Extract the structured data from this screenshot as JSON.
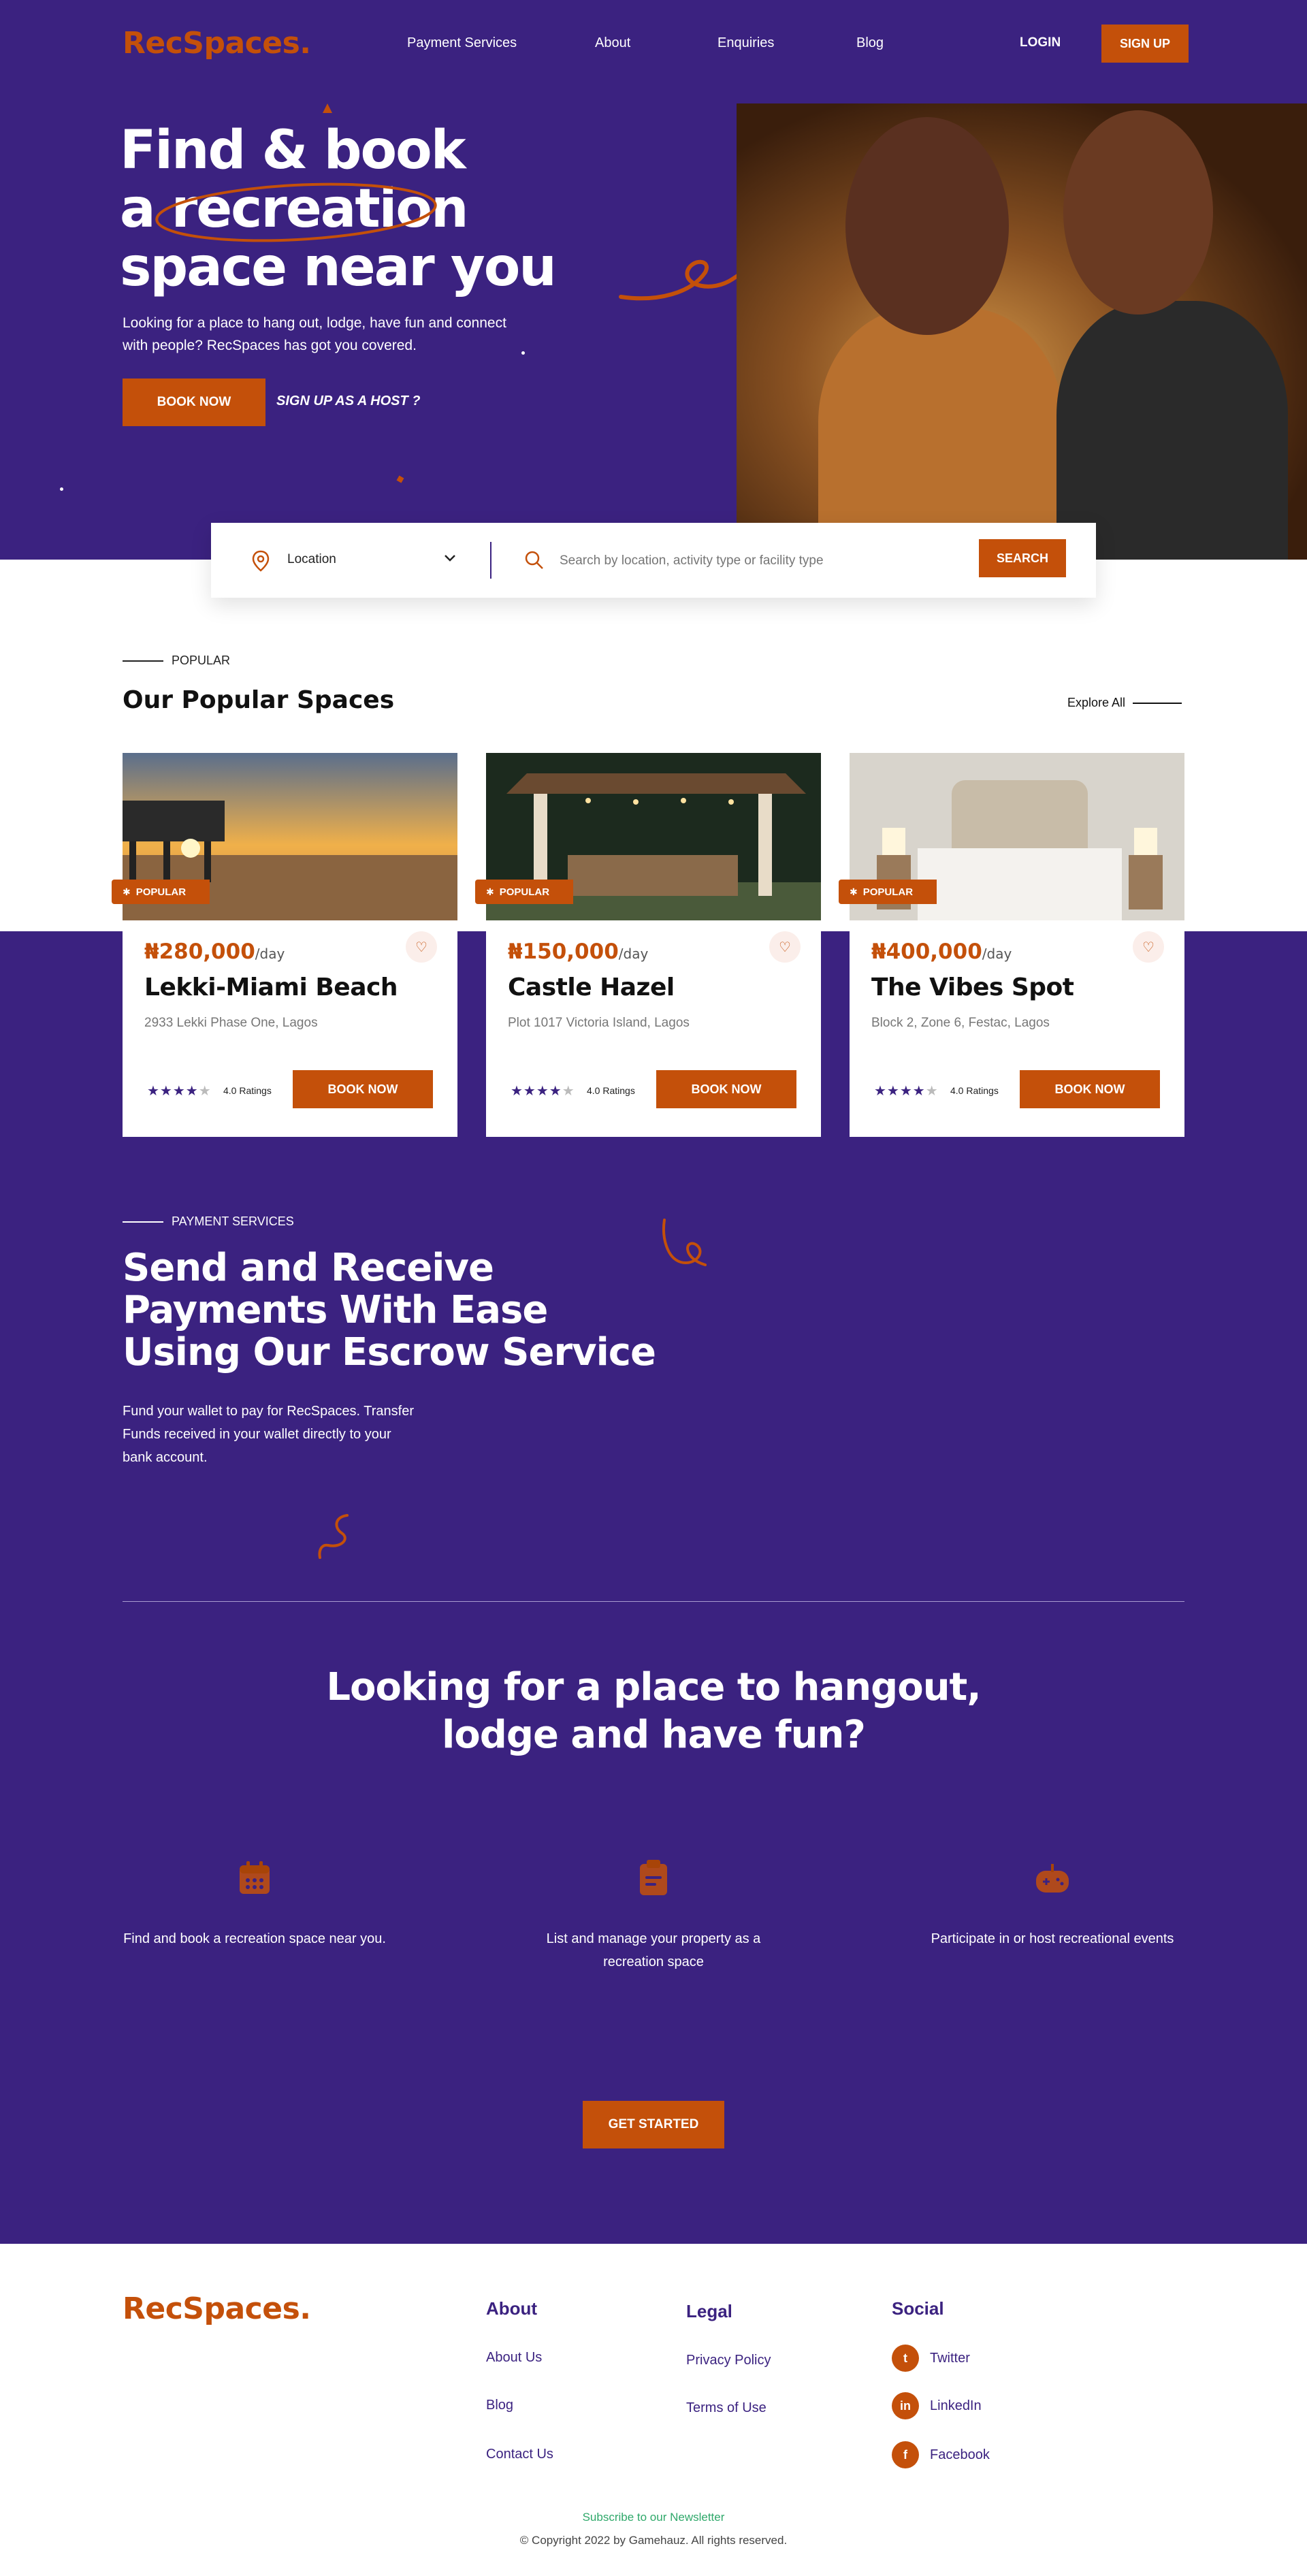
{
  "header": {
    "logo": "RecSpaces.",
    "nav": [
      "Payment Services",
      "About",
      "Enquiries",
      "Blog"
    ],
    "login": "LOGIN",
    "signup": "SIGN UP"
  },
  "hero": {
    "title_lines": [
      "Find & book",
      "a recreation",
      "space near you"
    ],
    "description": "Looking for a place to hang out, lodge, have fun and connect with people? RecSpaces has got you covered.",
    "book_now": "BOOK NOW",
    "host_link": "SIGN UP AS A HOST ?"
  },
  "search": {
    "location_label": "Location",
    "placeholder": "Search by location, activity type or facility type",
    "button": "SEARCH"
  },
  "popular": {
    "eyebrow": "POPULAR",
    "title": "Our Popular Spaces",
    "explore": "Explore All",
    "cards": [
      {
        "badge": "POPULAR",
        "price": "₦280,000",
        "per": "/day",
        "name": "Lekki-Miami Beach",
        "address": "2933 Lekki Phase One, Lagos",
        "stars": 4,
        "ratings": "4.0 Ratings",
        "button": "BOOK NOW"
      },
      {
        "badge": "POPULAR",
        "price": "₦150,000",
        "per": "/day",
        "name": "Castle Hazel",
        "address": "Plot 1017 Victoria Island, Lagos",
        "stars": 4,
        "ratings": "4.0 Ratings",
        "button": "BOOK NOW"
      },
      {
        "badge": "POPULAR",
        "price": "₦400,000",
        "per": "/day",
        "name": "The Vibes Spot",
        "address": "Block 2, Zone 6, Festac, Lagos",
        "stars": 4,
        "ratings": "4.0 Ratings",
        "button": "BOOK NOW"
      }
    ]
  },
  "payment": {
    "eyebrow": "PAYMENT SERVICES",
    "title_lines": [
      "Send and Receive",
      "Payments With Ease",
      "Using Our Escrow Service"
    ],
    "description": "Fund your wallet to pay for RecSpaces. Transfer Funds received in your wallet directly to your bank account."
  },
  "looking": {
    "title_lines": [
      "Looking for a place to hangout,",
      "lodge and have fun?"
    ],
    "features": [
      {
        "icon": "calendar-icon",
        "text": "Find and book a recreation space near you."
      },
      {
        "icon": "clipboard-icon",
        "text": "List and manage your property as a recreation space"
      },
      {
        "icon": "gamepad-icon",
        "text": "Participate in or host recreational events"
      }
    ],
    "cta": "GET STARTED"
  },
  "footer": {
    "logo": "RecSpaces.",
    "about": {
      "title": "About",
      "links": [
        "About Us",
        "Blog",
        "Contact Us"
      ]
    },
    "legal": {
      "title": "Legal",
      "links": [
        "Privacy Policy",
        "Terms of Use"
      ]
    },
    "social": {
      "title": "Social",
      "links": [
        "Twitter",
        "LinkedIn",
        "Facebook"
      ]
    },
    "newsletter": "Subscribe to our Newsletter",
    "copyright": "© Copyright 2022 by Gamehauz. All rights reserved."
  },
  "colors": {
    "brand_purple": "#3b2280",
    "brand_orange": "#c4500a"
  }
}
